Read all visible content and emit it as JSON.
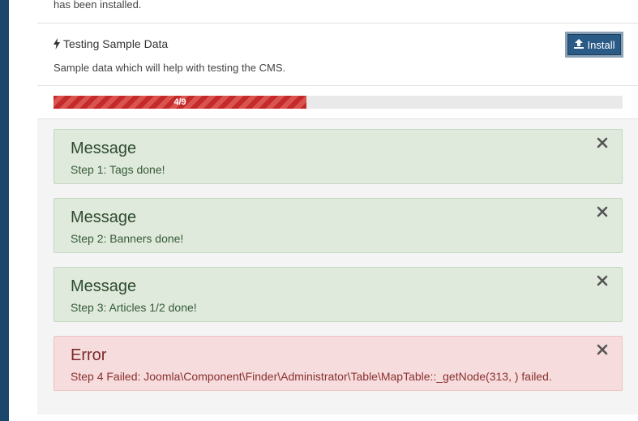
{
  "previous_item": {
    "trailing_text": "has been installed."
  },
  "sample_data": {
    "title": "Testing Sample Data",
    "title_icon": "bolt-icon",
    "description": "Sample data which will help with testing the CMS.",
    "install_label": "Install",
    "install_icon": "upload-icon"
  },
  "progress": {
    "label": "4/9",
    "current": 4,
    "total": 9,
    "fill_color": "#c52a2a"
  },
  "alerts": [
    {
      "type": "message",
      "heading": "Message",
      "text": "Step 1: Tags done!"
    },
    {
      "type": "message",
      "heading": "Message",
      "text": "Step 2: Banners done!"
    },
    {
      "type": "message",
      "heading": "Message",
      "text": "Step 3: Articles 1/2 done!"
    },
    {
      "type": "error",
      "heading": "Error",
      "text": "Step 4 Failed: Joomla\\Component\\Finder\\Administrator\\Table\\MapTable::_getNode(313, ) failed."
    }
  ],
  "colors": {
    "sidebar": "#1d466b",
    "install_button": "#2a5a86",
    "message_bg": "#dfeadd",
    "error_bg": "#f6dcdc"
  }
}
